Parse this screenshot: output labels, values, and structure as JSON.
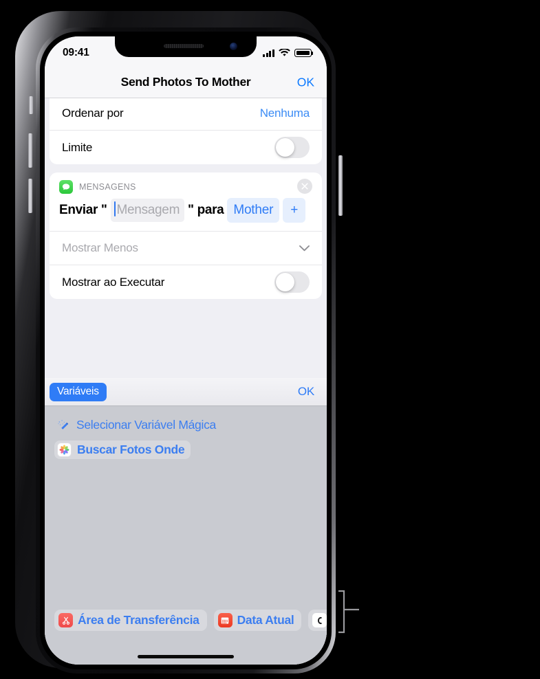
{
  "status_bar": {
    "time": "09:41",
    "cellular_icon": "signal-bars-icon",
    "wifi_icon": "wifi-icon",
    "battery_icon": "battery-full-icon"
  },
  "nav_bar": {
    "title": "Send Photos To Mother",
    "done_label": "OK"
  },
  "settings_card": {
    "rows": [
      {
        "label": "Ordenar por",
        "value": "Nenhuma",
        "type": "value"
      },
      {
        "label": "Limite",
        "value": "",
        "type": "toggle",
        "on": false
      }
    ]
  },
  "action_card": {
    "app_name": "MENSAGENS",
    "app_icon": "messages-icon",
    "close_icon": "close-circle-icon",
    "text_before": "Enviar \"",
    "message_placeholder": "Mensagem",
    "text_after": "\" para",
    "recipient": "Mother",
    "add_label": "+",
    "show_less_label": "Mostrar Menos",
    "chevron_icon": "chevron-down-icon",
    "show_when_run_label": "Mostrar ao Executar",
    "show_when_run_on": false
  },
  "variables_panel": {
    "tab_label": "Variáveis",
    "done_label": "OK",
    "items": [
      {
        "label": "Selecionar Variável Mágica",
        "icon": "magic-wand-icon",
        "chip": false
      },
      {
        "label": "Buscar Fotos Onde",
        "icon": "photos-icon",
        "chip": true
      }
    ],
    "toolbar_chips": [
      {
        "label": "Área de Transferência",
        "icon": "clipboard-scissors-icon"
      },
      {
        "label": "Data Atual",
        "icon": "calendar-icon"
      },
      {
        "label": "",
        "icon": "shortcut-input-icon"
      }
    ]
  },
  "colors": {
    "accent_blue": "#2f7cf6",
    "link_blue": "#3c8cf5",
    "messages_green": "#2bc73a",
    "panel_gray": "#c9cbd1",
    "clipboard_red": "#ef4a4a",
    "date_red": "#ec3a22"
  }
}
